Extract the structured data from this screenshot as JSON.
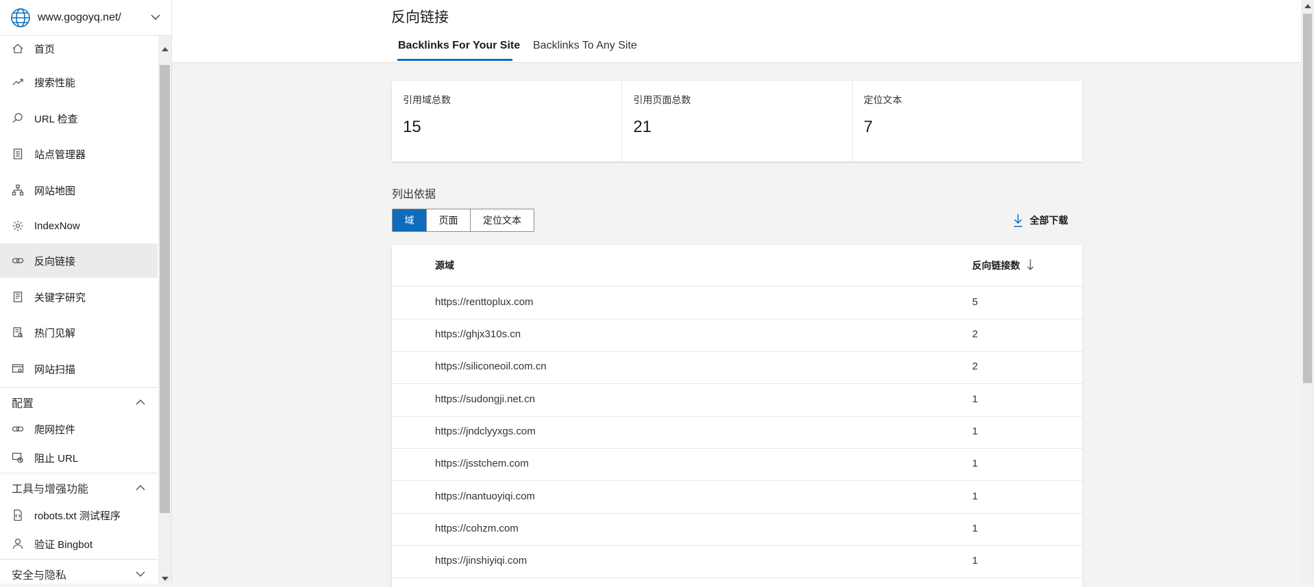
{
  "site": {
    "url": "www.gogoyq.net/"
  },
  "sidebar": {
    "items": [
      {
        "label": "首页",
        "icon": "home-icon"
      },
      {
        "label": "搜索性能",
        "icon": "trend-icon"
      },
      {
        "label": "URL 检查",
        "icon": "search-icon"
      },
      {
        "label": "站点管理器",
        "icon": "clipboard-icon"
      },
      {
        "label": "网站地图",
        "icon": "sitemap-icon"
      },
      {
        "label": "IndexNow",
        "icon": "gear-icon"
      },
      {
        "label": "反向链接",
        "icon": "link-icon",
        "active": true
      },
      {
        "label": "关键字研究",
        "icon": "document-icon"
      },
      {
        "label": "热门见解",
        "icon": "insight-icon"
      },
      {
        "label": "网站扫描",
        "icon": "scan-icon"
      }
    ],
    "groups": {
      "config": {
        "label": "配置",
        "items": [
          {
            "label": "爬网控件",
            "icon": "link-icon"
          },
          {
            "label": "阻止 URL",
            "icon": "block-url-icon"
          }
        ]
      },
      "tools": {
        "label": "工具与增强功能",
        "items": [
          {
            "label": "robots.txt 测试程序",
            "icon": "code-file-icon"
          },
          {
            "label": "验证 Bingbot",
            "icon": "bot-icon"
          }
        ]
      },
      "security": {
        "label": "安全与隐私"
      }
    }
  },
  "header": {
    "title": "反向链接",
    "tabs": [
      {
        "label": "Backlinks For Your Site",
        "active": true
      },
      {
        "label": "Backlinks To Any Site",
        "active": false
      }
    ]
  },
  "stats": [
    {
      "label": "引用域总数",
      "value": "15"
    },
    {
      "label": "引用页面总数",
      "value": "21"
    },
    {
      "label": "定位文本",
      "value": "7"
    }
  ],
  "list_by": {
    "label": "列出依据",
    "options": [
      {
        "label": "域",
        "active": true
      },
      {
        "label": "页面",
        "active": false
      },
      {
        "label": "定位文本",
        "active": false
      }
    ]
  },
  "download": {
    "label": "全部下载"
  },
  "table": {
    "columns": {
      "domain": "源域",
      "count": "反向链接数"
    },
    "sort": "descending",
    "rows": [
      {
        "domain": "https://renttoplux.com",
        "count": "5"
      },
      {
        "domain": "https://ghjx310s.cn",
        "count": "2"
      },
      {
        "domain": "https://siliconeoil.com.cn",
        "count": "2"
      },
      {
        "domain": "https://sudongji.net.cn",
        "count": "1"
      },
      {
        "domain": "https://jndclyyxgs.com",
        "count": "1"
      },
      {
        "domain": "https://jsstchem.com",
        "count": "1"
      },
      {
        "domain": "https://nantuoyiqi.com",
        "count": "1"
      },
      {
        "domain": "https://cohzm.com",
        "count": "1"
      },
      {
        "domain": "https://jinshiyiqi.com",
        "count": "1"
      }
    ]
  },
  "colors": {
    "accent": "#0f6cbd",
    "active_nav_bg": "#ebebeb",
    "page_bg": "#f3f3f3"
  }
}
